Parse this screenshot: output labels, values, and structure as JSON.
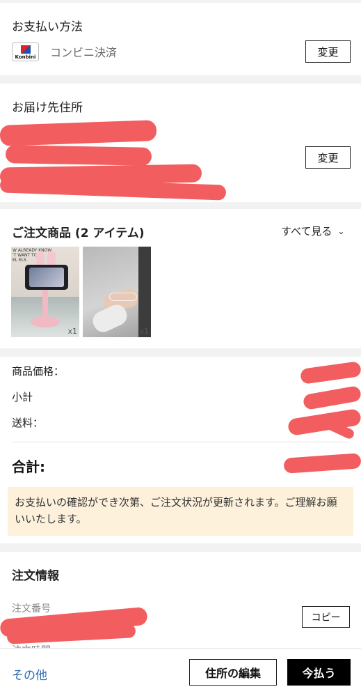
{
  "payment": {
    "title": "お支払い方法",
    "logo_text": "Konbini",
    "method": "コンビニ決済",
    "change_label": "変更"
  },
  "delivery": {
    "title": "お届け先住所",
    "change_label": "変更"
  },
  "items": {
    "title": "ご注文商品 (2 アイテム)",
    "see_all": "すべて見る",
    "products": [
      {
        "qty": "x1"
      },
      {
        "qty": "x1"
      }
    ],
    "product1_caption": [
      "W ALREADY KNOW",
      "'T WANT TO",
      "EL ELS"
    ]
  },
  "summary": {
    "price_label": "商品価格：",
    "subtotal_label": "小計",
    "shipping_label": "送料：",
    "total_label": "合計:"
  },
  "notice": {
    "text": "お支払いの確認ができ次第、ご注文状況が更新されます。ご理解お願いいたします。"
  },
  "order_info": {
    "title": "注文情報",
    "order_no_label": "注文番号",
    "order_time_label": "注文時間",
    "copy_label": "コピー"
  },
  "footer": {
    "other_label": "その他",
    "edit_address_label": "住所の編集",
    "pay_now_label": "今払う"
  },
  "colors": {
    "accent_link": "#2b6cb0",
    "notice_bg": "#fdf1dc",
    "redaction": "#f25d5f"
  }
}
